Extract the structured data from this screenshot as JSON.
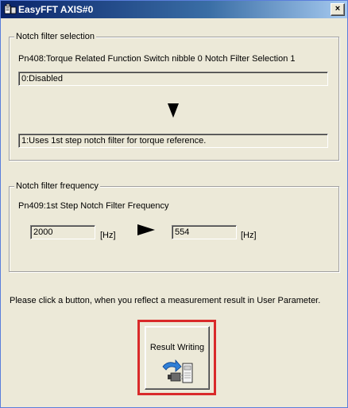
{
  "window": {
    "title": "EasyFFT AXIS#0",
    "close_label": "×"
  },
  "notch_selection": {
    "legend": "Notch filter selection",
    "parameter_label": "Pn408:Torque Related Function Switch  nibble 0 Notch Filter Selection 1",
    "before_value": "0:Disabled",
    "after_value": "1:Uses 1st step notch filter for torque reference."
  },
  "notch_frequency": {
    "legend": "Notch filter frequency",
    "parameter_label": "Pn409:1st Step Notch Filter Frequency",
    "before_value": "2000",
    "before_unit": "[Hz]",
    "after_value": "554",
    "after_unit": "[Hz]"
  },
  "instruction": "Please click a button, when you reflect a measurement result in User Parameter.",
  "result_button": {
    "label": "Result Writing"
  },
  "colors": {
    "title_gradient_start": "#0a246a",
    "highlight_frame": "#d92a2a",
    "dialog_bg": "#ece9d8"
  },
  "icons": {
    "title": "app-icon",
    "down_arrow": "down-arrow-icon",
    "right_arrow": "right-arrow-icon",
    "write": "write-to-device-icon"
  }
}
